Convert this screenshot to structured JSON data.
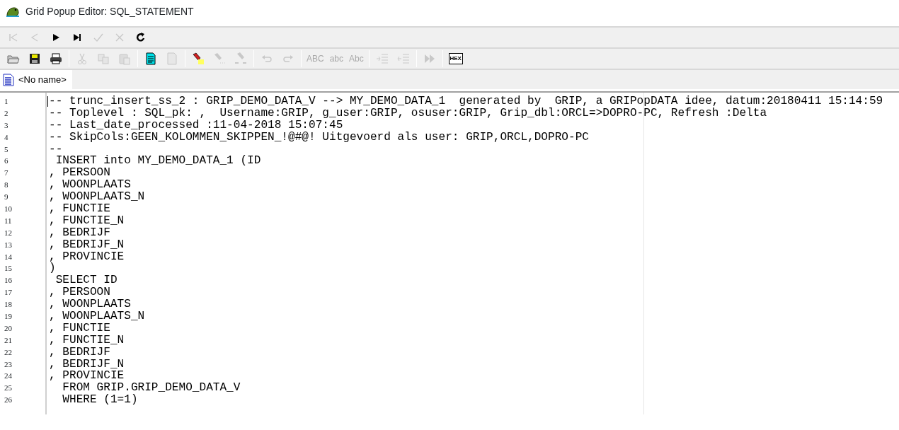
{
  "window": {
    "title": "Grid Popup Editor: SQL_STATEMENT"
  },
  "nav_toolbar": [
    {
      "kind": "first",
      "disabled": true
    },
    {
      "kind": "prev",
      "disabled": true
    },
    {
      "kind": "next",
      "disabled": false
    },
    {
      "kind": "last",
      "disabled": false
    },
    {
      "kind": "post",
      "disabled": true
    },
    {
      "kind": "cancel",
      "disabled": true
    },
    {
      "kind": "refresh",
      "disabled": false
    }
  ],
  "edit_toolbar": [
    {
      "kind": "open",
      "disabled": false
    },
    {
      "kind": "save",
      "disabled": false
    },
    {
      "kind": "print",
      "disabled": false
    },
    {
      "kind": "sep"
    },
    {
      "kind": "cut",
      "disabled": true
    },
    {
      "kind": "copy",
      "disabled": true
    },
    {
      "kind": "paste",
      "disabled": true
    },
    {
      "kind": "sep"
    },
    {
      "kind": "doc",
      "disabled": false
    },
    {
      "kind": "blank",
      "disabled": true
    },
    {
      "kind": "sep"
    },
    {
      "kind": "highlight",
      "disabled": false
    },
    {
      "kind": "find",
      "disabled": true
    },
    {
      "kind": "replace",
      "disabled": true
    },
    {
      "kind": "sep"
    },
    {
      "kind": "undo",
      "disabled": true
    },
    {
      "kind": "redo",
      "disabled": true
    },
    {
      "kind": "sep"
    },
    {
      "kind": "text",
      "label": "ABC",
      "disabled": true
    },
    {
      "kind": "text",
      "label": "abc",
      "disabled": true
    },
    {
      "kind": "text",
      "label": "Abc",
      "disabled": true
    },
    {
      "kind": "sep"
    },
    {
      "kind": "indent",
      "disabled": true
    },
    {
      "kind": "outdent",
      "disabled": true
    },
    {
      "kind": "sep"
    },
    {
      "kind": "run",
      "disabled": true
    },
    {
      "kind": "sep"
    },
    {
      "kind": "hex",
      "label": "HEX",
      "disabled": false
    }
  ],
  "tabs": [
    {
      "label": "<No name>",
      "selected": true
    }
  ],
  "editor": {
    "lines": [
      {
        "number": "1",
        "text": "-- trunc_insert_ss_2 : GRIP_DEMO_DATA_V --> MY_DEMO_DATA_1  generated by  GRIP, a GRIPopDATA idee, datum:20180411 15:14:59"
      },
      {
        "number": "2",
        "text": "-- Toplevel : SQL_pk: ,  Username:GRIP, g_user:GRIP, osuser:GRIP, Grip_dbl:ORCL=>DOPRO-PC, Refresh :Delta"
      },
      {
        "number": "3",
        "text": "-- Last_date_processed :11-04-2018 15:07:45"
      },
      {
        "number": "4",
        "text": "-- SkipCols:GEEN_KOLOMMEN_SKIPPEN_!@#@! Uitgevoerd als user: GRIP,ORCL,DOPRO-PC"
      },
      {
        "number": "5",
        "text": "--"
      },
      {
        "number": "6",
        "text": " INSERT into MY_DEMO_DATA_1 (ID"
      },
      {
        "number": "7",
        "text": ", PERSOON"
      },
      {
        "number": "8",
        "text": ", WOONPLAATS"
      },
      {
        "number": "9",
        "text": ", WOONPLAATS_N"
      },
      {
        "number": "10",
        "text": ", FUNCTIE"
      },
      {
        "number": "11",
        "text": ", FUNCTIE_N"
      },
      {
        "number": "12",
        "text": ", BEDRIJF"
      },
      {
        "number": "13",
        "text": ", BEDRIJF_N"
      },
      {
        "number": "14",
        "text": ", PROVINCIE"
      },
      {
        "number": "15",
        "text": ")"
      },
      {
        "number": "16",
        "text": " SELECT ID"
      },
      {
        "number": "17",
        "text": ", PERSOON"
      },
      {
        "number": "18",
        "text": ", WOONPLAATS"
      },
      {
        "number": "19",
        "text": ", WOONPLAATS_N"
      },
      {
        "number": "20",
        "text": ", FUNCTIE"
      },
      {
        "number": "21",
        "text": ", FUNCTIE_N"
      },
      {
        "number": "22",
        "text": ", BEDRIJF"
      },
      {
        "number": "23",
        "text": ", BEDRIJF_N"
      },
      {
        "number": "24",
        "text": ", PROVINCIE"
      },
      {
        "number": "25",
        "text": "  FROM GRIP.GRIP_DEMO_DATA_V"
      },
      {
        "number": "26",
        "text": "  WHERE (1=1)"
      }
    ]
  }
}
